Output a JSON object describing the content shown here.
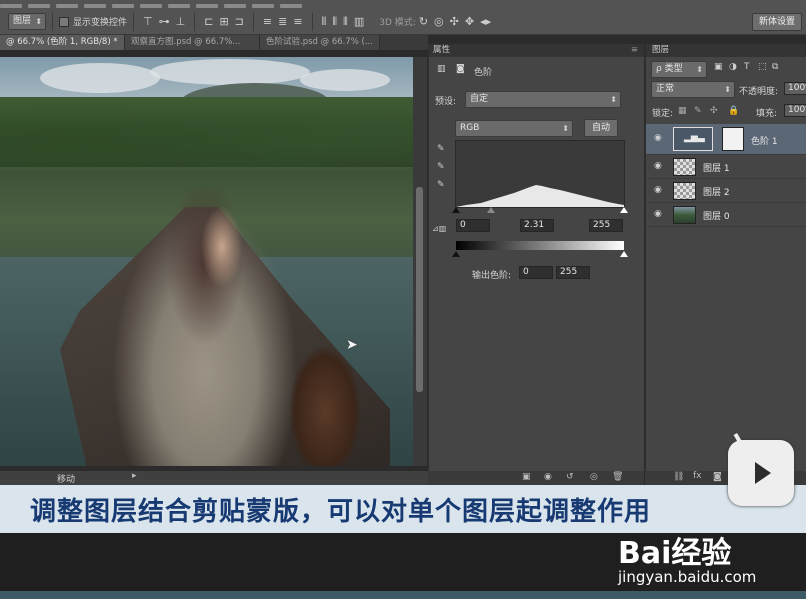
{
  "options_bar": {
    "layer_select": "图层",
    "show_transform": "显示变换控件",
    "mode_3d": "3D 模式:",
    "new_workspace": "新体设置"
  },
  "doc_tabs": [
    {
      "label": "@ 66.7% (色阶 1, RGB/8) *",
      "active": true
    },
    {
      "label": "观察直方图.psd @ 66.7%...",
      "active": false
    },
    {
      "label": "色阶试验.psd @ 66.7% (...",
      "active": false
    }
  ],
  "status": {
    "zoom": "移动"
  },
  "properties": {
    "title": "属性",
    "panel_name": "色阶",
    "preset_label": "预设:",
    "preset_value": "自定",
    "channel": "RGB",
    "auto_button": "自动",
    "input_black": "0",
    "input_gamma": "2.31",
    "input_white": "255",
    "output_label": "输出色阶:",
    "output_black": "0",
    "output_white": "255"
  },
  "layers": {
    "title": "图层",
    "filter": "ρ 类型",
    "blend_mode": "正常",
    "opacity_label": "不透明度:",
    "opacity_value": "100%",
    "lock_label": "锁定:",
    "fill_label": "填充:",
    "fill_value": "100%",
    "items": [
      {
        "name": "色阶 1",
        "selected": true,
        "kind": "adjustment"
      },
      {
        "name": "图层 1",
        "selected": false,
        "kind": "pixel"
      },
      {
        "name": "图层 2",
        "selected": false,
        "kind": "pixel"
      },
      {
        "name": "图层 0",
        "selected": false,
        "kind": "photo"
      }
    ]
  },
  "subtitle": "调整图层结合剪贴蒙版，可以对单个图层起调整作用",
  "watermark": {
    "brand": "Bai经验",
    "url": "jingyan.baidu.com"
  }
}
